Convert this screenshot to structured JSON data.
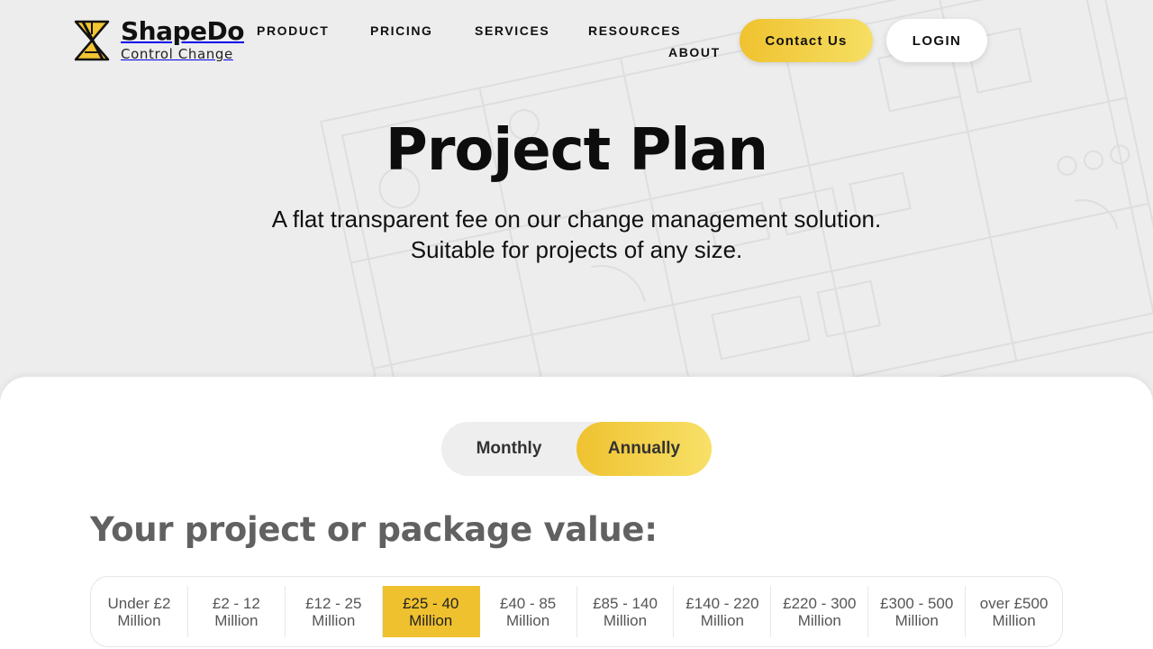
{
  "brand": {
    "name": "ShapeDo",
    "tagline": "Control Change"
  },
  "nav": {
    "product": "PRODUCT",
    "pricing": "PRICING",
    "services": "SERVICES",
    "resources": "RESOURCES",
    "about": "ABOUT"
  },
  "header_actions": {
    "contact": "Contact Us",
    "login": "LOGIN"
  },
  "hero": {
    "title": "Project Plan",
    "subtitle_line1": "A flat transparent fee on our change management solution.",
    "subtitle_line2": "Suitable for projects of any size."
  },
  "billing_toggle": {
    "monthly": "Monthly",
    "annually": "Annually",
    "selected": "Annually"
  },
  "package": {
    "heading": "Your project or package value:",
    "selected_index": 3,
    "ranges": [
      "Under £2 Million",
      "£2 - 12 Million",
      "£12 - 25 Million",
      "£25 - 40 Million",
      "£40 - 85 Million",
      "£85 - 140 Million",
      "£140 - 220 Million",
      "£220 - 300 Million",
      "£300 - 500 Million",
      "over £500 Million"
    ]
  },
  "colors": {
    "accent": "#f0c12f",
    "background": "#ededed",
    "panel": "#ffffff"
  }
}
